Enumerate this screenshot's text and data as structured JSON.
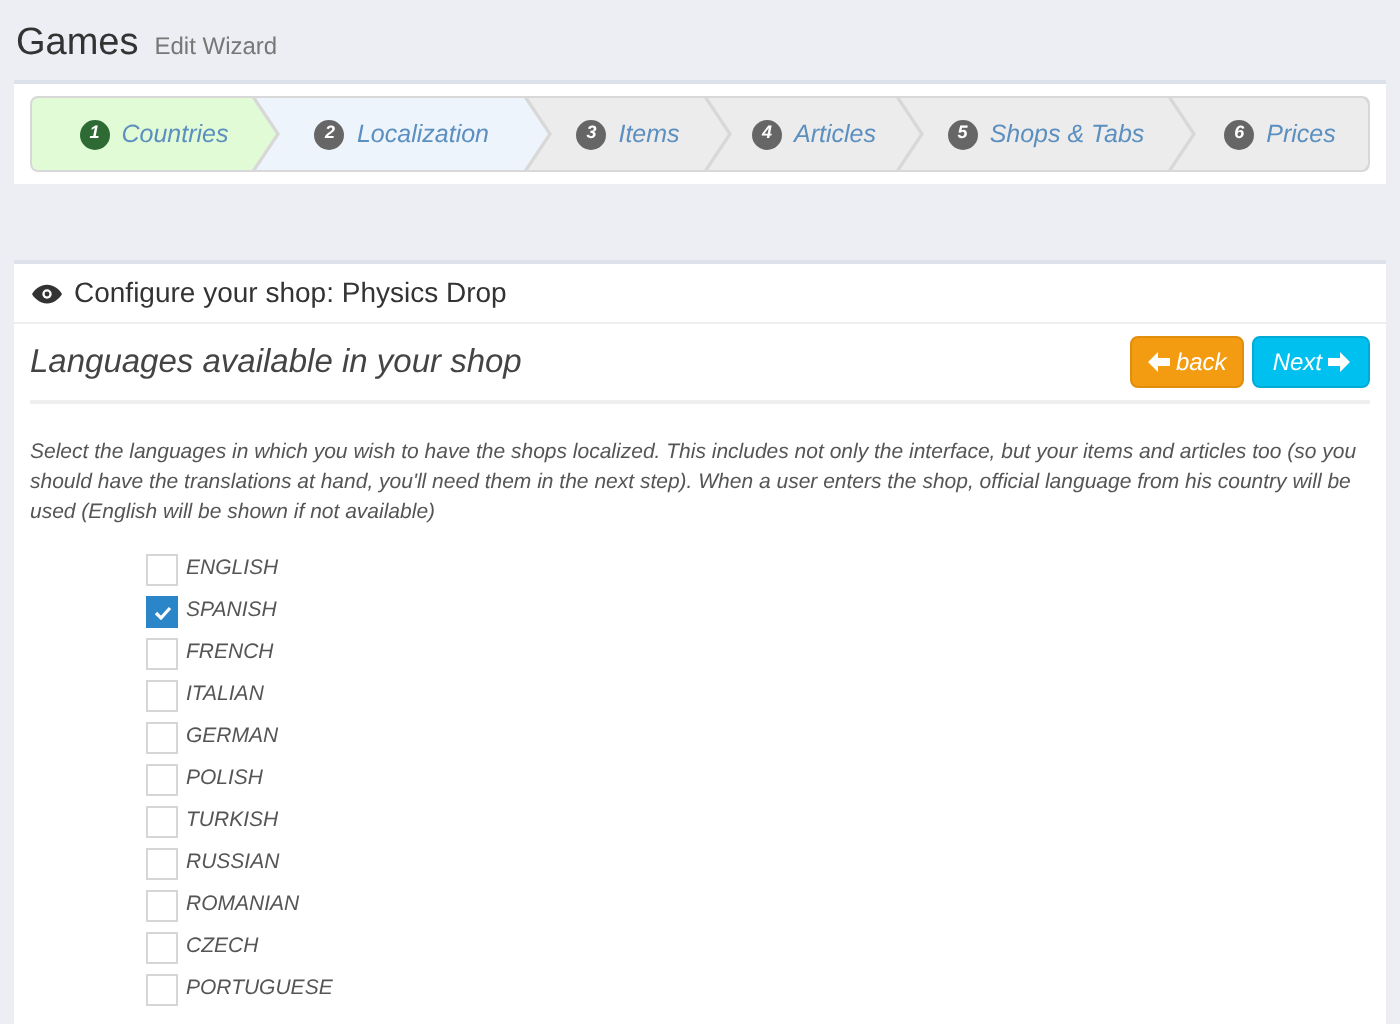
{
  "page": {
    "title": "Games",
    "subtitle": "Edit Wizard"
  },
  "steps": [
    {
      "number": "1",
      "label": "Countries",
      "completed": true,
      "selected": false
    },
    {
      "number": "2",
      "label": "Localization",
      "completed": false,
      "selected": true
    },
    {
      "number": "3",
      "label": "Items",
      "completed": false,
      "selected": false
    },
    {
      "number": "4",
      "label": "Articles",
      "completed": false,
      "selected": false
    },
    {
      "number": "5",
      "label": "Shops & Tabs",
      "completed": false,
      "selected": false
    },
    {
      "number": "6",
      "label": "Prices",
      "completed": false,
      "selected": false
    }
  ],
  "panel": {
    "title": "Configure your shop: Physics Drop",
    "heading": "Languages available in your shop",
    "back_button": "back",
    "next_button": "Next",
    "description": "Select the languages in which you wish to have the shops localized. This includes not only the interface, but your items and articles too (so you should have the translations at hand, you'll need them in the next step). When a user enters the shop, official language from his country will be used (English will be shown if not available)"
  },
  "languages": [
    {
      "label": "ENGLISH",
      "checked": false
    },
    {
      "label": "SPANISH",
      "checked": true
    },
    {
      "label": "FRENCH",
      "checked": false
    },
    {
      "label": "ITALIAN",
      "checked": false
    },
    {
      "label": "GERMAN",
      "checked": false
    },
    {
      "label": "POLISH",
      "checked": false
    },
    {
      "label": "TURKISH",
      "checked": false
    },
    {
      "label": "RUSSIAN",
      "checked": false
    },
    {
      "label": "ROMANIAN",
      "checked": false
    },
    {
      "label": "CZECH",
      "checked": false
    },
    {
      "label": "PORTUGUESE",
      "checked": false
    }
  ]
}
